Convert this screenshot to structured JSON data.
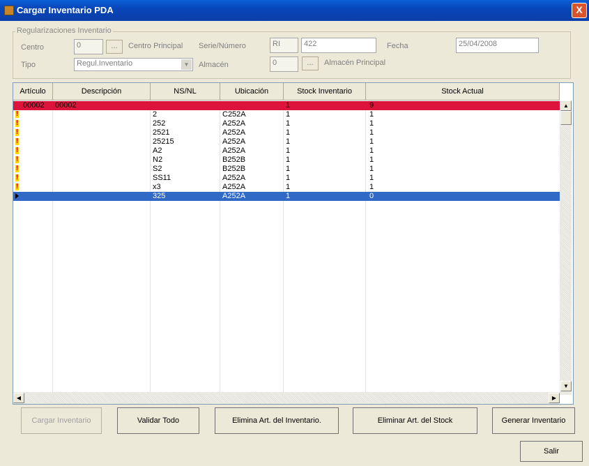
{
  "window": {
    "title": "Cargar Inventario PDA",
    "close_label": "X"
  },
  "group": {
    "title": "Regularizaciones Inventario",
    "centro_label": "Centro",
    "centro_value": "0",
    "centro_desc": "Centro Principal",
    "serie_label": "Serie/Número",
    "serie_value": "RI",
    "numero_value": "422",
    "fecha_label": "Fecha",
    "fecha_value": "25/04/2008",
    "tipo_label": "Tipo",
    "tipo_value": "Regul.Inventario",
    "almacen_label": "Almacén",
    "almacen_value": "0",
    "almacen_desc": "Almacén Principal",
    "ellipsis": "..."
  },
  "grid": {
    "columns": [
      "Artículo",
      "Descripción",
      "NS/NL",
      "Ubicación",
      "Stock Inventario",
      "Stock Actual"
    ],
    "rows": [
      {
        "articulo": "00002",
        "descripcion": "00002",
        "nsnl": "",
        "ubicacion": "",
        "stock_inv": "1",
        "stock_act": "9",
        "state": "red",
        "marker": ""
      },
      {
        "articulo": "",
        "descripcion": "",
        "nsnl": "2",
        "ubicacion": "C252A",
        "stock_inv": "1",
        "stock_act": "1",
        "state": "warn",
        "marker": "!"
      },
      {
        "articulo": "",
        "descripcion": "",
        "nsnl": "252",
        "ubicacion": "A252A",
        "stock_inv": "1",
        "stock_act": "1",
        "state": "warn",
        "marker": "!"
      },
      {
        "articulo": "",
        "descripcion": "",
        "nsnl": "2521",
        "ubicacion": "A252A",
        "stock_inv": "1",
        "stock_act": "1",
        "state": "warn",
        "marker": "!"
      },
      {
        "articulo": "",
        "descripcion": "",
        "nsnl": "25215",
        "ubicacion": "A252A",
        "stock_inv": "1",
        "stock_act": "1",
        "state": "warn",
        "marker": "!"
      },
      {
        "articulo": "",
        "descripcion": "",
        "nsnl": "A2",
        "ubicacion": "A252A",
        "stock_inv": "1",
        "stock_act": "1",
        "state": "warn",
        "marker": "!"
      },
      {
        "articulo": "",
        "descripcion": "",
        "nsnl": "N2",
        "ubicacion": "B252B",
        "stock_inv": "1",
        "stock_act": "1",
        "state": "warn",
        "marker": "!"
      },
      {
        "articulo": "",
        "descripcion": "",
        "nsnl": "S2",
        "ubicacion": "B252B",
        "stock_inv": "1",
        "stock_act": "1",
        "state": "warn",
        "marker": "!"
      },
      {
        "articulo": "",
        "descripcion": "",
        "nsnl": "SS11",
        "ubicacion": "A252A",
        "stock_inv": "1",
        "stock_act": "1",
        "state": "warn",
        "marker": "!"
      },
      {
        "articulo": "",
        "descripcion": "",
        "nsnl": "x3",
        "ubicacion": "A252A",
        "stock_inv": "1",
        "stock_act": "1",
        "state": "warn",
        "marker": "!"
      },
      {
        "articulo": "",
        "descripcion": "",
        "nsnl": "325",
        "ubicacion": "A252A",
        "stock_inv": "1",
        "stock_act": "0",
        "state": "sel",
        "marker": ""
      }
    ]
  },
  "buttons": {
    "cargar": "Cargar Inventario",
    "validar": "Validar Todo",
    "elimina_inv": "Elimina Art. del Inventario.",
    "eliminar_stock": "Eliminar Art. del Stock",
    "generar": "Generar Inventario",
    "salir": "Salir"
  }
}
